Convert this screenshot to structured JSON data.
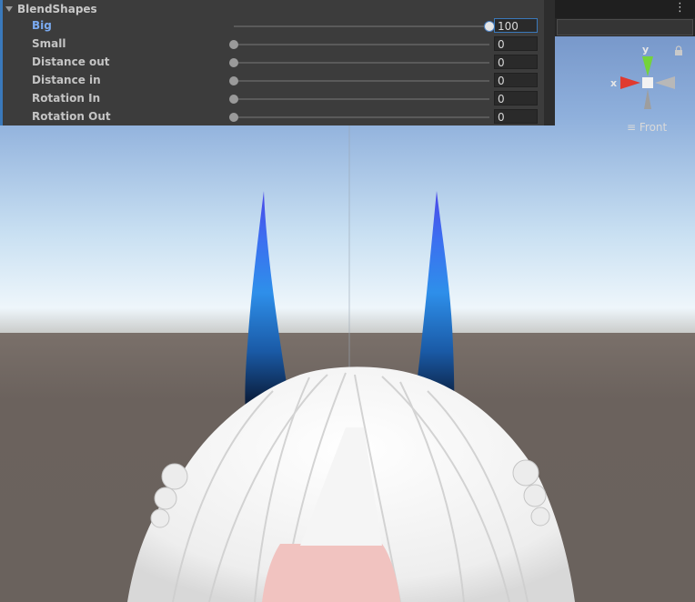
{
  "inspector": {
    "section_title": "BlendShapes",
    "blendshapes": [
      {
        "label": "Big",
        "value": "100",
        "fraction": 1.0,
        "active": true
      },
      {
        "label": "Small",
        "value": "0",
        "fraction": 0.0,
        "active": false
      },
      {
        "label": "Distance out",
        "value": "0",
        "fraction": 0.0,
        "active": false
      },
      {
        "label": "Distance in",
        "value": "0",
        "fraction": 0.0,
        "active": false
      },
      {
        "label": "Rotation In",
        "value": "0",
        "fraction": 0.0,
        "active": false
      },
      {
        "label": "Rotation Out",
        "value": "0",
        "fraction": 0.0,
        "active": false
      }
    ]
  },
  "toolbar": {
    "menu_icon": "kebab-icon"
  },
  "gizmo": {
    "y_label": "y",
    "x_label": "x",
    "view_label": "Front",
    "colors": {
      "x": "#e03a2f",
      "y": "#74d33b",
      "z": "#4a7ad8"
    }
  },
  "scene": {
    "sky_top": "#6f90c4",
    "horizon": "#e8f2f8",
    "ground": "#6e6661",
    "horn_top": "#4a55e6",
    "horn_mid": "#2f8ce8",
    "horn_base": "#050d1a",
    "hair": "#f2f2f2"
  }
}
